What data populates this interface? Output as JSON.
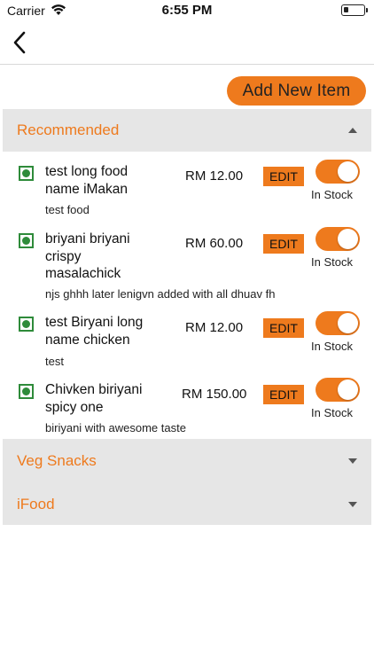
{
  "status_bar": {
    "carrier": "Carrier",
    "time": "6:55 PM"
  },
  "nav": {
    "back_icon": "chevron-left-icon"
  },
  "add_button_label": "Add New Item",
  "colors": {
    "accent": "#ee7a1d",
    "veg_green": "#2e8b3a",
    "section_bg": "#e6e6e6"
  },
  "categories": [
    {
      "title": "Recommended",
      "expanded": true,
      "items": [
        {
          "name": "test long food name iMakan",
          "price": "RM 12.00",
          "edit_label": "EDIT",
          "in_stock": true,
          "stock_label": "In Stock",
          "description": "test food"
        },
        {
          "name": "briyani briyani crispy masalachick",
          "price": "RM 60.00",
          "edit_label": "EDIT",
          "in_stock": true,
          "stock_label": "In Stock",
          "description": "njs ghhh later lenigvn added with all dhuav fh"
        },
        {
          "name": "test Biryani long name chicken",
          "price": "RM 12.00",
          "edit_label": "EDIT",
          "in_stock": true,
          "stock_label": "In Stock",
          "description": "test"
        },
        {
          "name": "Chivken biriyani spicy one",
          "price": "RM 150.00",
          "edit_label": "EDIT",
          "in_stock": true,
          "stock_label": "In Stock",
          "description": "biriyani with awesome taste"
        }
      ]
    },
    {
      "title": "Veg Snacks",
      "expanded": false,
      "items": []
    },
    {
      "title": "iFood",
      "expanded": false,
      "items": []
    }
  ]
}
